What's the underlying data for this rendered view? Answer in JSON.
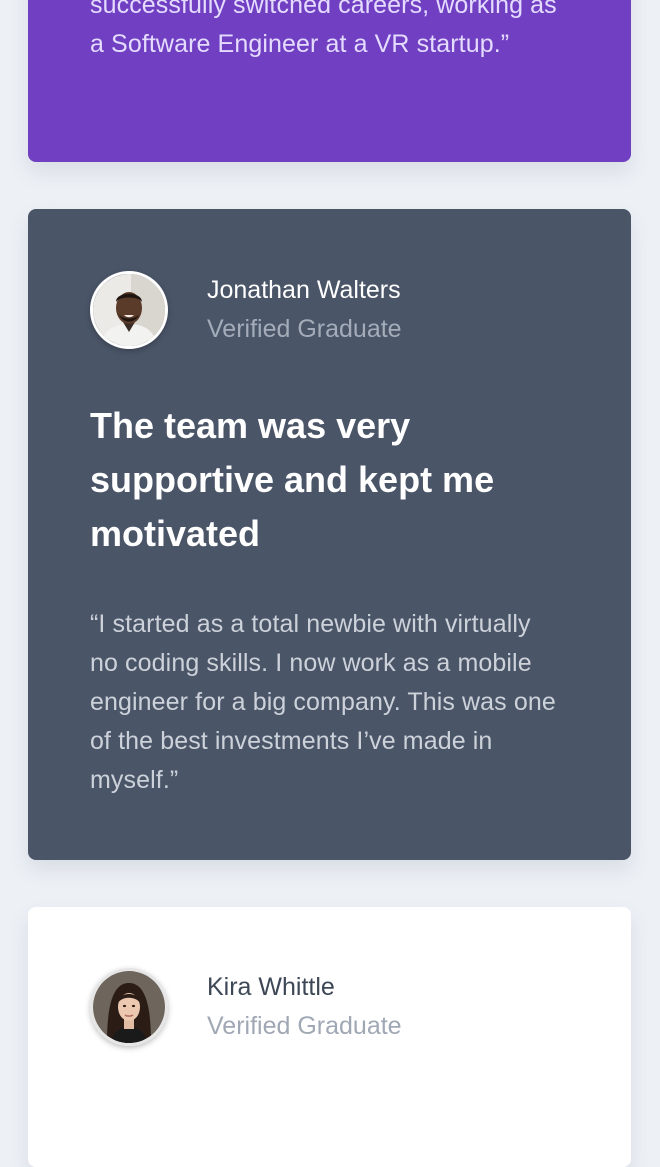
{
  "testimonials": [
    {
      "quote": "successfully switched careers, working as a Software Engineer at a VR startup.”"
    },
    {
      "name": "Jonathan Walters",
      "role": "Verified Graduate",
      "headline": "The team was very supportive and kept me motivated",
      "quote": "“I started as a total newbie with virtually no coding skills. I now work as a mobile engineer for a big company. This was one of the best investments I’ve made in myself.”"
    },
    {
      "name": "Kira Whittle",
      "role": "Verified Graduate"
    }
  ]
}
